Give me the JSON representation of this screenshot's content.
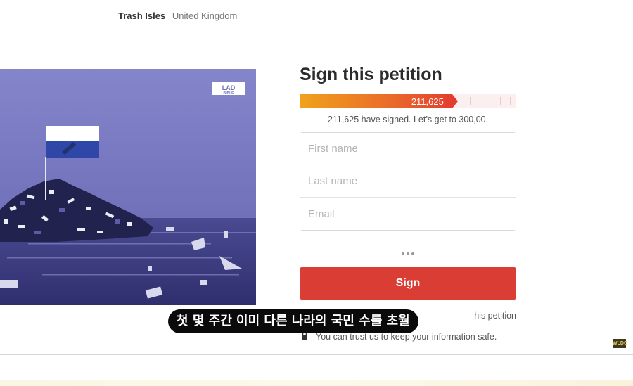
{
  "breadcrumb": {
    "link": "Trash Isles",
    "text": "United Kingdom"
  },
  "hero": {
    "logo_line1": "LAD",
    "logo_line2": "BIBLE"
  },
  "petition": {
    "title": "Sign this petition",
    "progress_label": "211,625",
    "progress_fraction": 0.7054,
    "count_text": "211,625 have signed. Let’s get to 300,00.",
    "first_name_placeholder": "First name",
    "last_name_placeholder": "Last name",
    "email_placeholder": "Email",
    "sign_label": "Sign",
    "share_text": "his petition",
    "trust_text": "You can trust us to keep your information safe."
  },
  "subtitle": {
    "text": "첫 몇 주간 이미 다른 나라의 국민 수를 초월"
  },
  "watermark": {
    "text": "WLDO"
  },
  "colors": {
    "accent": "#d93d33",
    "progress_start": "#f0a21c",
    "progress_end": "#e33d2f",
    "hero": "#7b7bc4"
  }
}
